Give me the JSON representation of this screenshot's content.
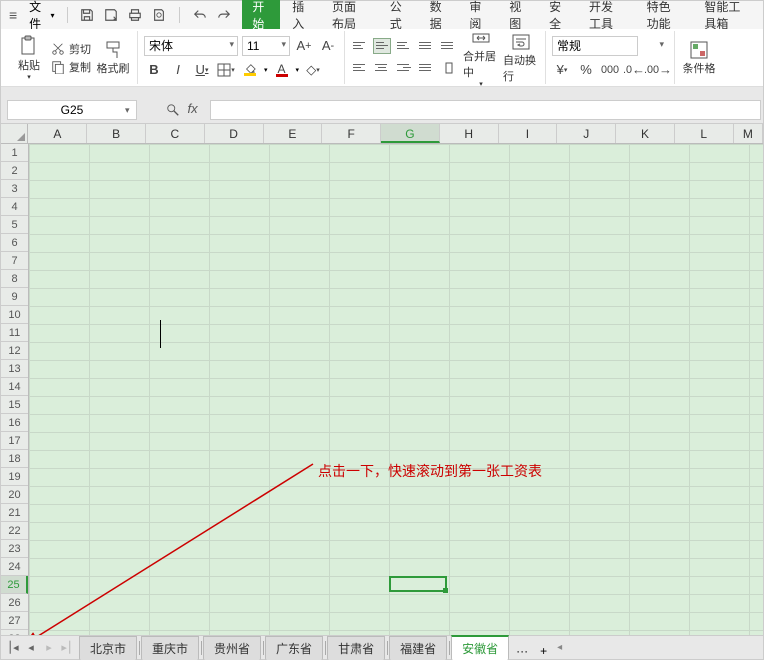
{
  "menubar": {
    "file_label": "文件",
    "tabs": [
      "开始",
      "插入",
      "页面布局",
      "公式",
      "数据",
      "审阅",
      "视图",
      "安全",
      "开发工具",
      "特色功能",
      "智能工具箱"
    ],
    "active_tab_index": 0
  },
  "ribbon": {
    "clipboard": {
      "paste_label": "粘贴",
      "cut_label": "剪切",
      "copy_label": "复制",
      "format_painter_label": "格式刷"
    },
    "font": {
      "family": "宋体",
      "size": "11"
    },
    "merge_center_label": "合并居中",
    "auto_wrap_label": "自动换行",
    "number_format_label": "常规",
    "cond_format_label": "条件格"
  },
  "formula_bar": {
    "name_box_value": "G25",
    "formula_value": ""
  },
  "grid": {
    "columns": [
      "A",
      "B",
      "C",
      "D",
      "E",
      "F",
      "G",
      "H",
      "I",
      "J",
      "K",
      "L",
      "M"
    ],
    "active_col_index": 6,
    "rows_count": 28,
    "active_row": 25,
    "selected_cell": {
      "col": 6,
      "row": 25
    }
  },
  "annotation": {
    "text": "点击一下，快速滚动到第一张工资表"
  },
  "sheet_tabs": {
    "tabs": [
      "北京市",
      "重庆市",
      "贵州省",
      "广东省",
      "甘肃省",
      "福建省",
      "安徽省"
    ],
    "active_index": 6,
    "more_label": "···",
    "add_label": "+"
  }
}
